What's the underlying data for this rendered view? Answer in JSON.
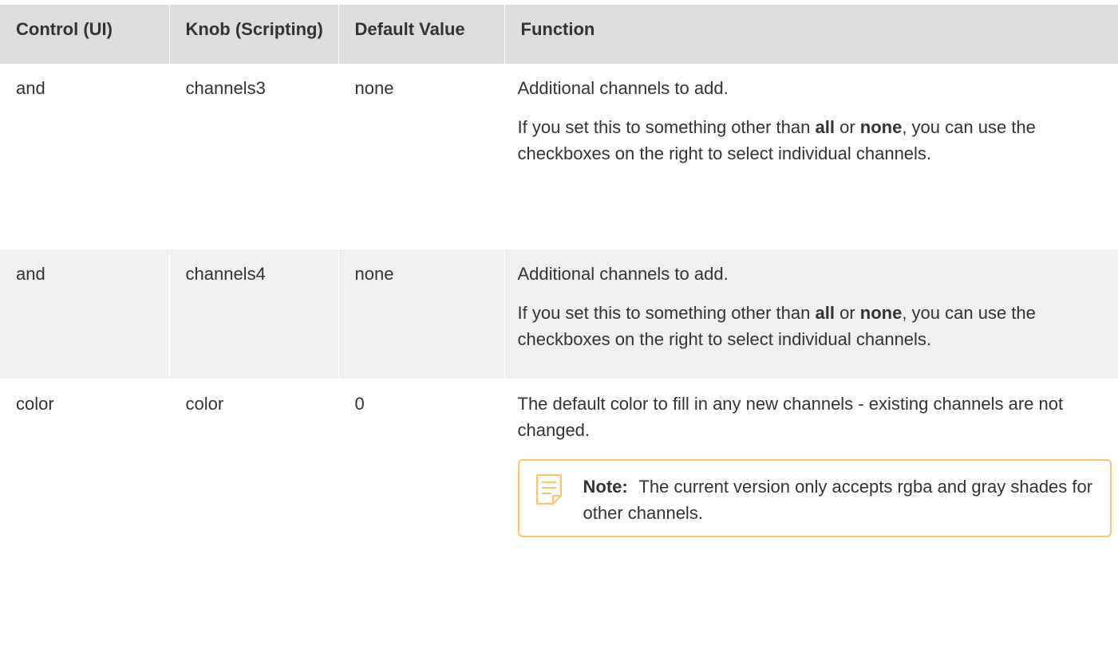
{
  "table": {
    "headers": [
      "Control (UI)",
      "Knob (Scripting)",
      "Default Value",
      "Function"
    ],
    "rows": [
      {
        "control": "and",
        "knob": "channels3",
        "default": "none",
        "function_p1": "Additional channels to add.",
        "function_p2_before": "If you set this to something other than ",
        "function_p2_bold1": "all",
        "function_p2_mid": " or ",
        "function_p2_bold2": "none",
        "function_p2_after": ", you can use the checkboxes on the right to select individual channels."
      },
      {
        "control": "and",
        "knob": "channels4",
        "default": "none",
        "function_p1": "Additional channels to add.",
        "function_p2_before": "If you set this to something other than ",
        "function_p2_bold1": "all",
        "function_p2_mid": " or ",
        "function_p2_bold2": "none",
        "function_p2_after": ", you can use the checkboxes on the right to select individual channels."
      },
      {
        "control": "color",
        "knob": "color",
        "default": "0",
        "function_p1": "The default color to fill in any new channels - existing channels are not changed.",
        "note_label": "Note:",
        "note_text": " The current version only accepts rgba and gray shades for other channels."
      }
    ]
  },
  "colors": {
    "header_bg": "#dddddd",
    "alt_row_bg": "#f0f0f0",
    "note_border": "#f7c56a",
    "note_icon": "#f7c56a",
    "text": "#333333"
  },
  "icons": {
    "note": "note-icon"
  }
}
